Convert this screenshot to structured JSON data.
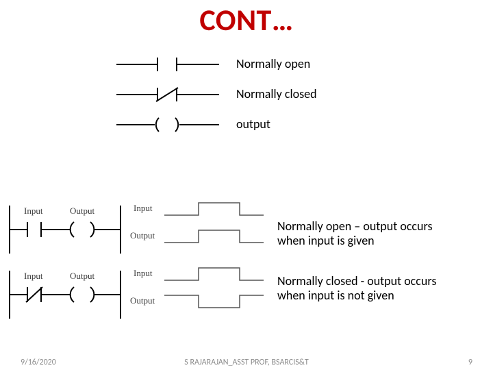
{
  "title": "CONT…",
  "symbols": {
    "no_label": "Normally open",
    "nc_label": "Normally closed",
    "out_label": "output"
  },
  "diagrams": {
    "input_label": "Input",
    "output_label": "Output",
    "no_desc_l1": "Normally open – output occurs",
    "no_desc_l2": "when input is given",
    "nc_desc_l1": "Normally closed - output occurs",
    "nc_desc_l2": "when input is not given"
  },
  "footer": {
    "date": "9/16/2020",
    "author": "S RAJARAJAN_ASST PROF, BSARCIS&T",
    "page": "9"
  }
}
